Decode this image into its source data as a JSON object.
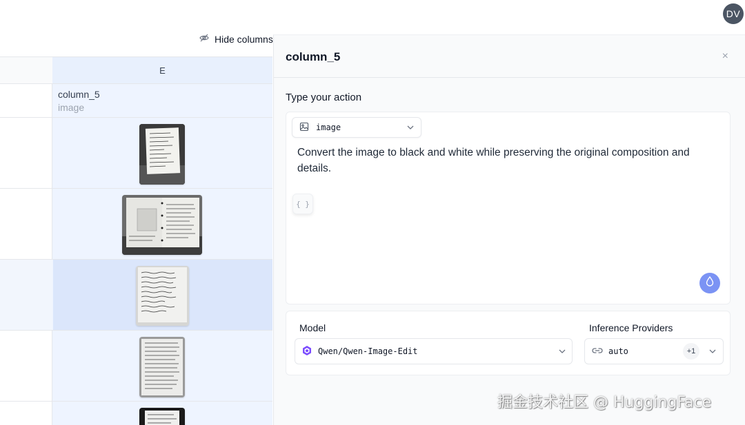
{
  "user": {
    "initials": "DV"
  },
  "toolbar": {
    "hide_columns_label": "Hide columns"
  },
  "grid": {
    "column_header": "E",
    "column_name": "column_5",
    "column_type": "image"
  },
  "panel": {
    "title": "column_5",
    "close_glyph": "×",
    "action_label": "Type your action",
    "output_type": "image",
    "prompt": "Convert the image to black and white while preserving the original composition and details.",
    "braces": "{ }",
    "model_label": "Model",
    "model_value": "Qwen/Qwen-Image-Edit",
    "providers_label": "Inference Providers",
    "provider_value": "auto",
    "provider_extra": "+1"
  },
  "watermark": "掘金技术社区 @ HuggingFace",
  "colors": {
    "selection": "#dbe6fb",
    "column_bg": "#eef4ff",
    "run_button": "#7b93f4"
  }
}
